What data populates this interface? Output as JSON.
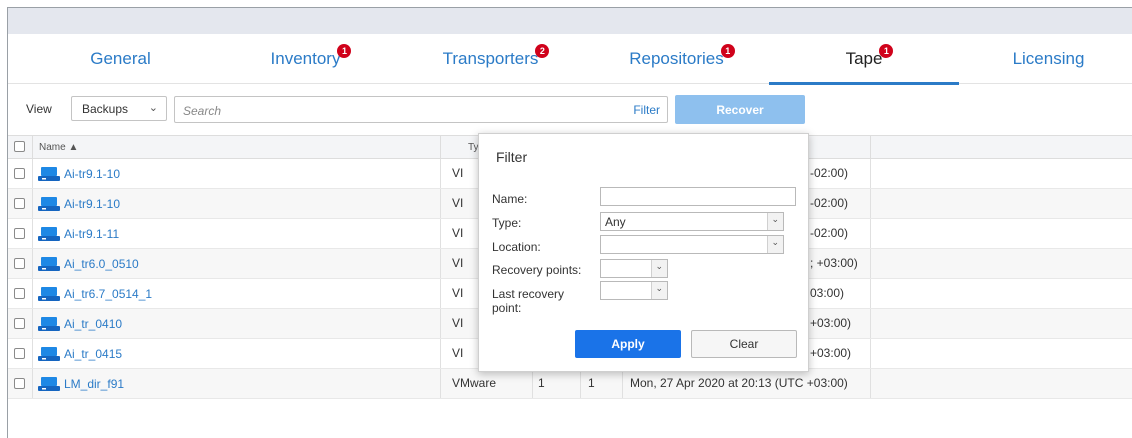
{
  "tabs": [
    {
      "label": "General"
    },
    {
      "label": "Inventory",
      "badge": "1"
    },
    {
      "label": "Transporters",
      "badge": "2"
    },
    {
      "label": "Repositories",
      "badge": "1"
    },
    {
      "label": "Tape",
      "badge": "1"
    },
    {
      "label": "Licensing"
    }
  ],
  "toolbar": {
    "view_label": "View",
    "view_value": "Backups",
    "search_placeholder": "Search",
    "filter_label": "Filter",
    "recover_label": "Recover"
  },
  "table": {
    "col_name": "Name",
    "col_type": "Ty",
    "rows": [
      {
        "name": "Ai-tr9.1-10",
        "type": "VI",
        "tail": "-02:00)"
      },
      {
        "name": "Ai-tr9.1-10",
        "type": "VI",
        "tail": "-02:00)"
      },
      {
        "name": "Ai-tr9.1-11",
        "type": "VI",
        "tail": "-02:00)"
      },
      {
        "name": "Ai_tr6.0_0510",
        "type": "VI",
        "tail": "; +03:00)"
      },
      {
        "name": "Ai_tr6.7_0514_1",
        "type": "VI",
        "tail": "03:00)"
      },
      {
        "name": "Ai_tr_0410",
        "type": "VI",
        "tail": "+03:00)"
      },
      {
        "name": "Ai_tr_0415",
        "type": "VI",
        "tail": "+03:00)"
      }
    ],
    "last_row": {
      "name": "LM_dir_f91",
      "type": "VMware",
      "c1": "1",
      "c2": "1",
      "date": "Mon, 27 Apr 2020 at 20:13 (UTC +03:00)"
    }
  },
  "filter": {
    "title": "Filter",
    "name_label": "Name:",
    "name_value": "",
    "type_label": "Type:",
    "type_value": "Any",
    "location_label": "Location:",
    "location_value": "",
    "recovery_points_label": "Recovery points:",
    "last_recovery_label_1": "Last recovery",
    "last_recovery_label_2": "point:",
    "apply_label": "Apply",
    "clear_label": "Clear"
  },
  "colors": {
    "accent": "#2b7bc7",
    "badge": "#d0021b",
    "apply": "#1a73e8",
    "recover_disabled": "#8ec0ee"
  }
}
